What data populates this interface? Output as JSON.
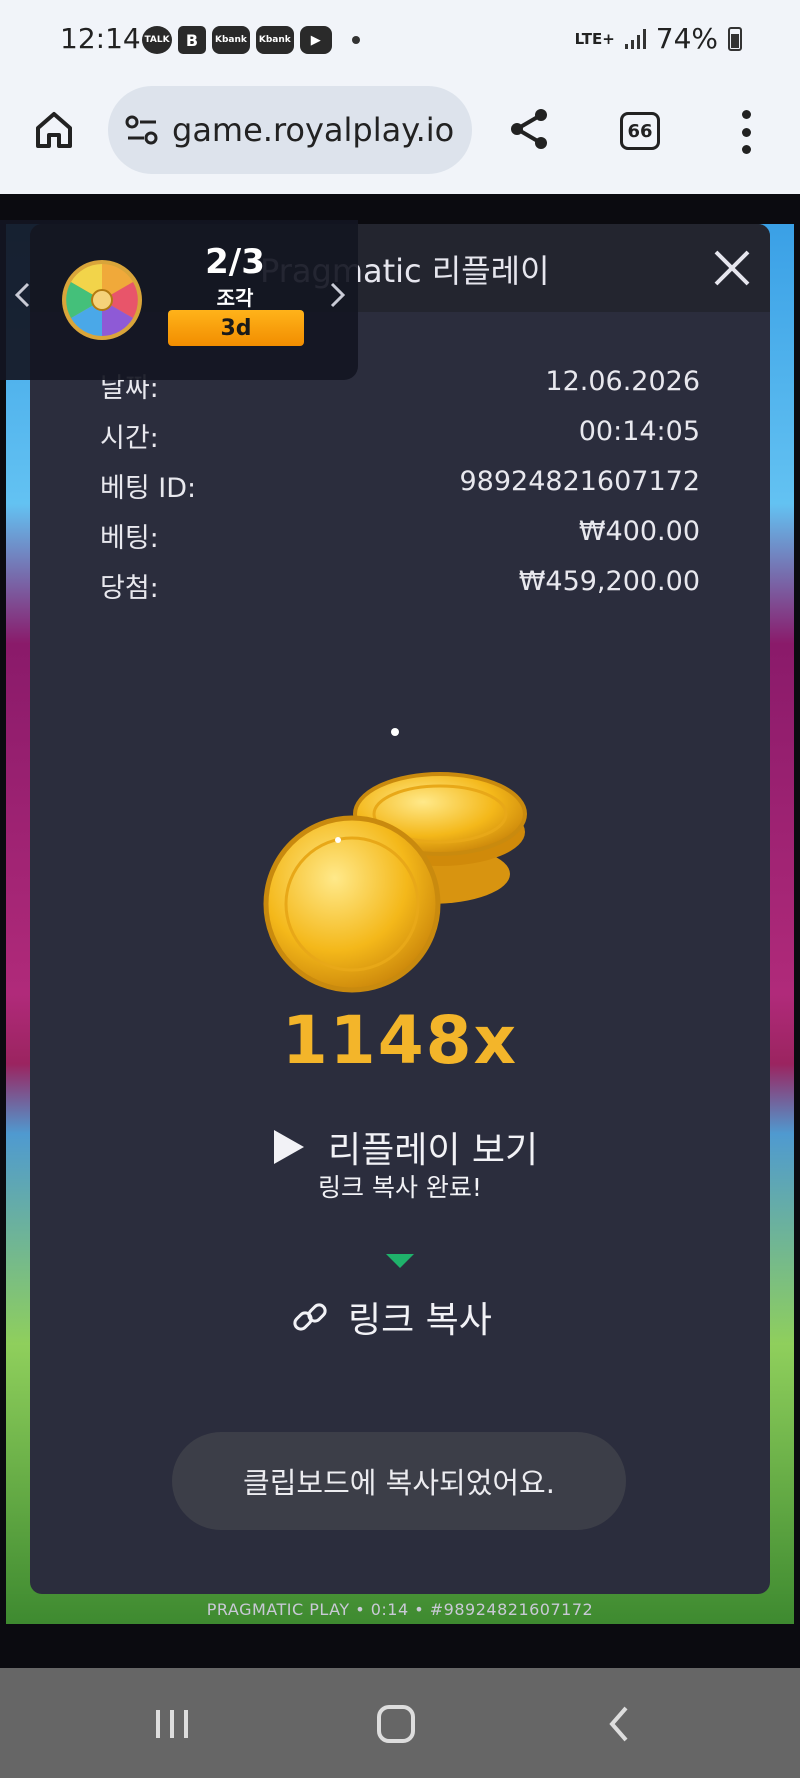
{
  "status_bar": {
    "time": "12:14",
    "notifications": [
      {
        "icon": "kakaotalk-icon",
        "text": "TALK"
      },
      {
        "icon": "b-app-icon",
        "text": "B"
      },
      {
        "icon": "kbank-icon",
        "text": "Kbank"
      },
      {
        "icon": "kbank-icon",
        "text": "Kbank"
      },
      {
        "icon": "youtube-icon",
        "text": "▶"
      }
    ],
    "network": "LTE+",
    "battery": "74%"
  },
  "browser": {
    "url": "game.royalplay.io",
    "tab_count": "66"
  },
  "wheel_promo": {
    "count": "2/3",
    "label": "조각",
    "badge": "3d"
  },
  "modal": {
    "title": "Pragmatic 리플레이",
    "rows": [
      {
        "label": "날짜:",
        "value": "12.06.2026"
      },
      {
        "label": "시간:",
        "value": "00:14:05"
      },
      {
        "label": "베팅 ID:",
        "value": "98924821607172"
      },
      {
        "label": "베팅:",
        "value": "₩400.00"
      },
      {
        "label": "당첨:",
        "value": "₩459,200.00"
      }
    ],
    "multiplier": "1148x",
    "replay_label": "리플레이 보기",
    "copied_label": "링크 복사 완료!",
    "copy_link_label": "링크 복사",
    "toast": "클립보드에 복사되었어요."
  },
  "game": {
    "footer": "PRAGMATIC PLAY • 0:14 • #98924821607172"
  },
  "colors": {
    "modal_bg": "#2b2d3d",
    "multiplier": "#f3b52a",
    "badge": "#f5a00a",
    "caret": "#1fb26b"
  }
}
